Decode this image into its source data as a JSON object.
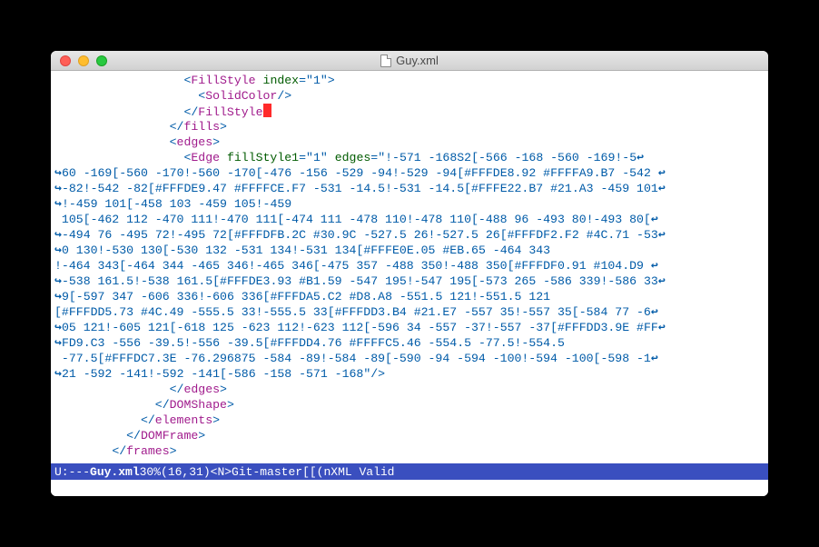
{
  "window": {
    "title": "Guy.xml"
  },
  "modeline": {
    "left": "U:---",
    "file": "Guy.xml",
    "percent": "30%",
    "pos": "(16,31)",
    "mode": "<N>",
    "vc": "Git-master",
    "tail": "[[(nXML Valid"
  },
  "code": {
    "indent1": "                  ",
    "indent2": "                    ",
    "indent3": "                      ",
    "indent4": "                ",
    "indent5": "              ",
    "lt": "<",
    "gt": ">",
    "lts": "</",
    "sc": "/>",
    "eq": "=",
    "q": "\"",
    "sp": " ",
    "tag_FillStyle": "FillStyle",
    "tag_SolidColor": "SolidColor",
    "tag_fills": "fills",
    "tag_edges": "edges",
    "tag_Edge": "Edge",
    "tag_DOMShape": "DOMShape",
    "tag_elements": "elements",
    "tag_DOMFrame": "DOMFrame",
    "tag_frames": "frames",
    "attr_fillStyle1": "fillStyle1",
    "attr_edges": "edges",
    "val_1": "1",
    "attr_index": "index",
    "top_partial_head": "FillStyle",
    "l1a": "!-571 -168S2[-566 -168 -560 -169!-5",
    "l2": "60 -169[-560 -170!-560 -170[-476 -156 -529 -94!-529 -94[#FFFDE8.92 #FFFFA9.B7 -542 ",
    "l3": "-82!-542 -82[#FFFDE9.47 #FFFFCE.F7 -531 -14.5!-531 -14.5[#FFFE22.B7 #21.A3 -459 101",
    "l4": "!-459 101[-458 103 -459 105!-459",
    "l5": " 105[-462 112 -470 111!-470 111[-474 111 -478 110!-478 110[-488 96 -493 80!-493 80[",
    "l6": "-494 76 -495 72!-495 72[#FFFDFB.2C #30.9C -527.5 26!-527.5 26[#FFFDF2.F2 #4C.71 -53",
    "l7": "0 130!-530 130[-530 132 -531 134!-531 134[#FFFE0E.05 #EB.65 -464 343",
    "l8": "!-464 343[-464 344 -465 346!-465 346[-475 357 -488 350!-488 350[#FFFDF0.91 #104.D9 ",
    "l9": "-538 161.5!-538 161.5[#FFFDE3.93 #B1.59 -547 195!-547 195[-573 265 -586 339!-586 33",
    "l10": "9[-597 347 -606 336!-606 336[#FFFDA5.C2 #D8.A8 -551.5 121!-551.5 121",
    "l11": "[#FFFDD5.73 #4C.49 -555.5 33!-555.5 33[#FFFDD3.B4 #21.E7 -557 35!-557 35[-584 77 -6",
    "l12": "05 121!-605 121[-618 125 -623 112!-623 112[-596 34 -557 -37!-557 -37[#FFFDD3.9E #FF",
    "l13": "FD9.C3 -556 -39.5!-556 -39.5[#FFFDD4.76 #FFFFC5.46 -554.5 -77.5!-554.5",
    "l14": " -77.5[#FFFDC7.3E -76.296875 -584 -89!-584 -89[-590 -94 -594 -100!-594 -100[-598 -1",
    "l15": "21 -592 -141!-592 -141[-586 -158 -571 -168"
  }
}
